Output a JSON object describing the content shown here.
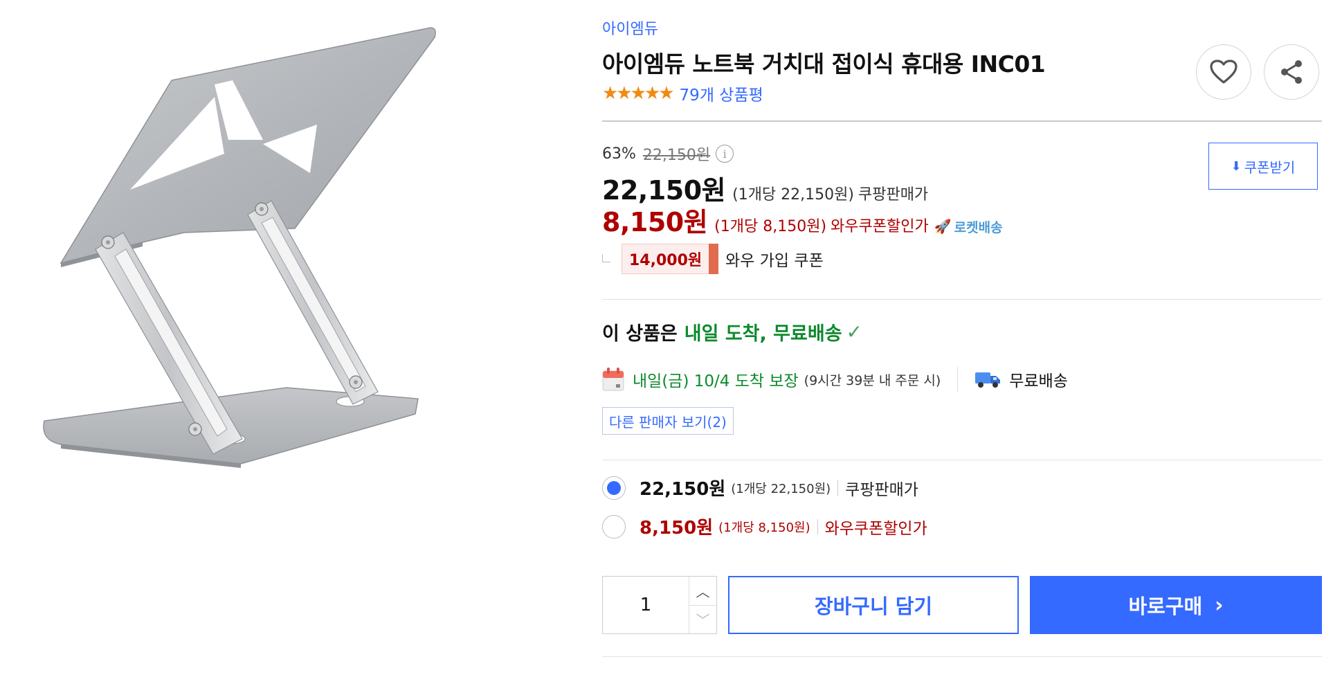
{
  "product": {
    "brand": "아이엠듀",
    "title": "아이엠듀 노트북 거치대 접이식 휴대용 INC01",
    "stars": "★★★★★",
    "review_count": "79개 상품평"
  },
  "pricing": {
    "discount_rate": "63%",
    "original_price": "22,150원",
    "info_glyph": "i",
    "coupon_button": "쿠폰받기",
    "coupon_icon": "⬇",
    "regular_price": "22,150원",
    "regular_unit": "(1개당 22,150원)",
    "regular_label": "쿠팡판매가",
    "wow_price": "8,150원",
    "wow_unit": "(1개당 8,150원)",
    "wow_label": "와우쿠폰할인가",
    "rocket_label": "로켓배송",
    "rocket_icon": "🚀",
    "wow_coupon_amount": "14,000원",
    "wow_coupon_text": "와우 가입 쿠폰"
  },
  "delivery": {
    "headline_prefix": "이 상품은",
    "headline_highlight": "내일 도착, 무료배송",
    "check_icon": "✓",
    "arrival_text": "내일(금) 10/4 도착 보장",
    "arrival_note": "(9시간 39분 내 주문 시)",
    "free_shipping": "무료배송",
    "other_sellers": "다른 판매자 보기(2)"
  },
  "options": [
    {
      "price": "22,150원",
      "unit": "(1개당 22,150원)",
      "label": "쿠팡판매가",
      "selected": true
    },
    {
      "price": "8,150원",
      "unit": "(1개당 8,150원)",
      "label": "와우쿠폰할인가",
      "selected": false
    }
  ],
  "purchase": {
    "quantity": "1",
    "up_glyph": "︿",
    "down_glyph": "﹀",
    "cart_label": "장바구니 담기",
    "buy_label": "바로구매",
    "buy_chevron": "›"
  },
  "colors": {
    "accent": "#346aff",
    "sale_red": "#ae0000",
    "delivery_green": "#0c8a2c",
    "star_orange": "#f08a13"
  },
  "icons": [
    "heart-icon",
    "share-icon",
    "info-icon",
    "download-icon",
    "rocket-icon",
    "check-icon",
    "calendar-icon",
    "truck-icon",
    "chevron-up-icon",
    "chevron-down-icon",
    "chevron-right-icon"
  ]
}
